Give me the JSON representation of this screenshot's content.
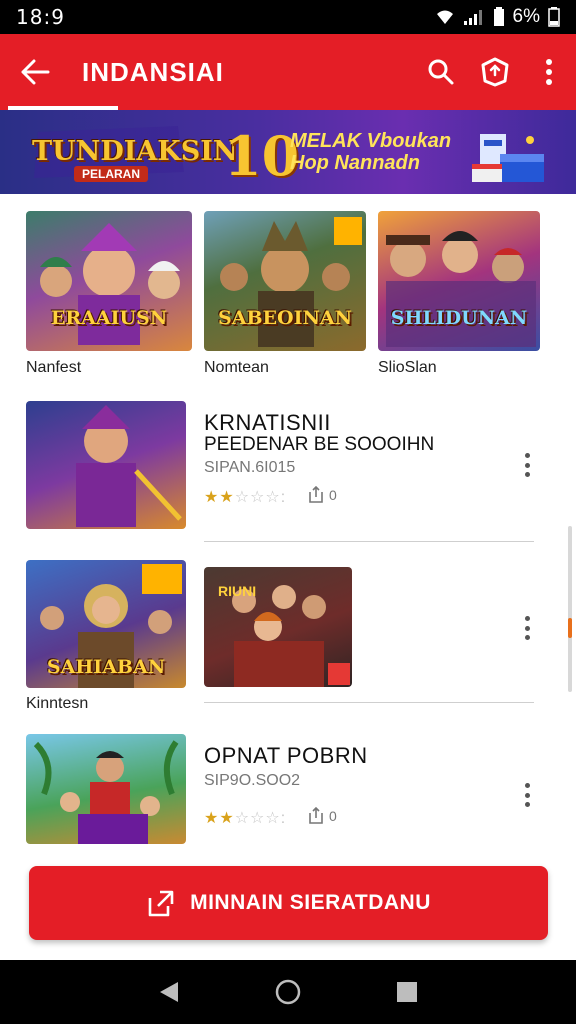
{
  "status_bar": {
    "time": "18:9",
    "battery": "6%"
  },
  "app_bar": {
    "title": "INDANSIAI"
  },
  "banner": {
    "logo": "TUNDIAKSIN",
    "logo_sub": "PELARAN",
    "big_number": "10",
    "promo_line1": "MELAK Vboukan",
    "promo_line2": "Hop Nannadn"
  },
  "grid": [
    {
      "thumb_text": "ERAAIUSN",
      "caption": "Nanfest"
    },
    {
      "thumb_text": "SABEOINAN",
      "caption": "Nomtean"
    },
    {
      "thumb_text": "SHLIDUNAN",
      "caption": "SlioSlan"
    }
  ],
  "list": [
    {
      "title": "KRNATISNII",
      "subtitle": "PEEDENAR BE SOOOIHN",
      "meta": "SIPAN.6I015",
      "rating": 2,
      "count_label": "0"
    },
    {
      "thumb_text": "SAHIABAN",
      "caption": "Kinntesn",
      "badge": "RIUNI"
    },
    {
      "title": "OPNAT POBRN",
      "meta": "SIP9O.SOO2",
      "rating": 2,
      "count_label": "0"
    }
  ],
  "cta": {
    "label": "MINNAIN SIERATDANU"
  },
  "colors": {
    "primary": "#e41e26",
    "star": "#d9a21b"
  },
  "icons": {
    "back": "arrow-left-icon",
    "search": "search-icon",
    "account": "shield-icon",
    "menu": "more-vert-icon",
    "share": "share-icon",
    "nav_back": "triangle-back-icon",
    "nav_home": "circle-home-icon",
    "nav_recent": "square-recent-icon"
  }
}
